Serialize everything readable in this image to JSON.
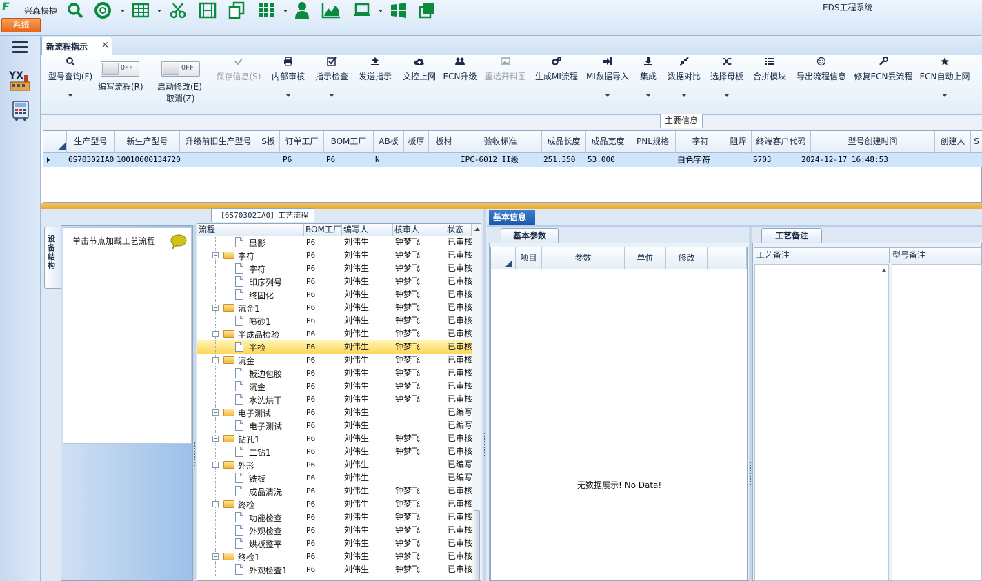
{
  "app": {
    "name": "兴森快捷",
    "system_tab": "系统",
    "title": "EDS工程系统"
  },
  "doc_tab": {
    "label": "新流程指示",
    "close": "×"
  },
  "toolbar": {
    "items": [
      {
        "label": "型号查询(F)",
        "icon": "search-icon"
      },
      {
        "label": "保存信息(S)",
        "icon": "check-icon",
        "disabled": true
      },
      {
        "label": "内部审核",
        "icon": "printer-icon"
      },
      {
        "label": "指示检查",
        "icon": "checkbox-icon"
      },
      {
        "label": "发送指示",
        "icon": "upload-icon"
      },
      {
        "label": "文控上网",
        "icon": "cloud-upload-icon"
      },
      {
        "label": "ECN升级",
        "icon": "people-icon"
      },
      {
        "label": "重选开料图",
        "icon": "picture-icon",
        "disabled": true
      },
      {
        "label": "生成MI流程",
        "icon": "gears-icon"
      },
      {
        "label": "MI数据导入",
        "icon": "sign-in-icon"
      },
      {
        "label": "集成",
        "icon": "download-icon"
      },
      {
        "label": "数据对比",
        "icon": "compress-icon"
      },
      {
        "label": "选择母板",
        "icon": "shuffle-icon"
      },
      {
        "label": "合拼模块",
        "icon": "list-icon"
      },
      {
        "label": "导出流程信息",
        "icon": "smile-icon"
      },
      {
        "label": "修复ECN丢流程",
        "icon": "wrench-icon"
      },
      {
        "label": "ECN自动上网",
        "icon": "star-icon"
      }
    ],
    "toggle1": {
      "label": "编写流程(R)",
      "state": "OFF"
    },
    "toggle2": {
      "label1": "启动修改(E)",
      "label2": "取消(Z)",
      "state": "OFF"
    }
  },
  "main_info": {
    "title": "主要信息",
    "headers": [
      "生产型号",
      "新生产型号",
      "升级前旧生产型号",
      "S板",
      "订单工厂",
      "BOM工厂",
      "AB板",
      "板厚",
      "板材",
      "验收标准",
      "成品长度",
      "成品宽度",
      "PNL规格",
      "字符",
      "阻焊",
      "终端客户代码",
      "型号创建时间",
      "创建人",
      "S"
    ],
    "row": [
      "6S70302IA0",
      "10010600134720",
      "",
      "",
      "P6",
      "P6",
      "N",
      "",
      "",
      "IPC-6012 II级",
      "251.350",
      "53.000",
      "",
      "白色字符",
      "",
      "S703",
      "2024-12-17 16:48:53",
      "",
      ""
    ]
  },
  "left_panel": {
    "vtab": "设备结构",
    "hint": "单击节点加载工艺流程"
  },
  "tree": {
    "title": "【6S70302IA0】工艺流程",
    "headers": [
      "流程",
      "BOM工厂",
      "编写人",
      "核审人",
      "状态"
    ],
    "rows": [
      {
        "level": 1,
        "name": "显影",
        "bom": "P6",
        "writer": "刘伟生",
        "reviewer": "钟梦飞",
        "status": "已审核"
      },
      {
        "level": 0,
        "name": "字符",
        "bom": "P6",
        "writer": "刘伟生",
        "reviewer": "钟梦飞",
        "status": "已审核"
      },
      {
        "level": 1,
        "name": "字符",
        "bom": "P6",
        "writer": "刘伟生",
        "reviewer": "钟梦飞",
        "status": "已审核"
      },
      {
        "level": 1,
        "name": "印序列号",
        "bom": "P6",
        "writer": "刘伟生",
        "reviewer": "钟梦飞",
        "status": "已审核"
      },
      {
        "level": 1,
        "name": "终固化",
        "bom": "P6",
        "writer": "刘伟生",
        "reviewer": "钟梦飞",
        "status": "已审核"
      },
      {
        "level": 0,
        "name": "沉金1",
        "bom": "P6",
        "writer": "刘伟生",
        "reviewer": "钟梦飞",
        "status": "已审核"
      },
      {
        "level": 1,
        "name": "喷砂1",
        "bom": "P6",
        "writer": "刘伟生",
        "reviewer": "钟梦飞",
        "status": "已审核"
      },
      {
        "level": 0,
        "name": "半成品检验",
        "bom": "P6",
        "writer": "刘伟生",
        "reviewer": "钟梦飞",
        "status": "已审核"
      },
      {
        "level": 1,
        "name": "半检",
        "bom": "P6",
        "writer": "刘伟生",
        "reviewer": "钟梦飞",
        "status": "已审核",
        "selected": true
      },
      {
        "level": 0,
        "name": "沉金",
        "bom": "P6",
        "writer": "刘伟生",
        "reviewer": "钟梦飞",
        "status": "已审核"
      },
      {
        "level": 1,
        "name": "板边包胶",
        "bom": "P6",
        "writer": "刘伟生",
        "reviewer": "钟梦飞",
        "status": "已审核"
      },
      {
        "level": 1,
        "name": "沉金",
        "bom": "P6",
        "writer": "刘伟生",
        "reviewer": "钟梦飞",
        "status": "已审核"
      },
      {
        "level": 1,
        "name": "水洗烘干",
        "bom": "P6",
        "writer": "刘伟生",
        "reviewer": "钟梦飞",
        "status": "已审核"
      },
      {
        "level": 0,
        "name": "电子测试",
        "bom": "P6",
        "writer": "刘伟生",
        "reviewer": "",
        "status": "已编写"
      },
      {
        "level": 1,
        "name": "电子测试",
        "bom": "P6",
        "writer": "刘伟生",
        "reviewer": "",
        "status": "已编写"
      },
      {
        "level": 0,
        "name": "钻孔1",
        "bom": "P6",
        "writer": "刘伟生",
        "reviewer": "钟梦飞",
        "status": "已审核"
      },
      {
        "level": 1,
        "name": "二钻1",
        "bom": "P6",
        "writer": "刘伟生",
        "reviewer": "钟梦飞",
        "status": "已审核"
      },
      {
        "level": 0,
        "name": "外形",
        "bom": "P6",
        "writer": "刘伟生",
        "reviewer": "",
        "status": "已编写"
      },
      {
        "level": 1,
        "name": "铣板",
        "bom": "P6",
        "writer": "刘伟生",
        "reviewer": "",
        "status": "已编写"
      },
      {
        "level": 1,
        "name": "成品清洗",
        "bom": "P6",
        "writer": "刘伟生",
        "reviewer": "钟梦飞",
        "status": "已审核"
      },
      {
        "level": 0,
        "name": "终检",
        "bom": "P6",
        "writer": "刘伟生",
        "reviewer": "钟梦飞",
        "status": "已审核"
      },
      {
        "level": 1,
        "name": "功能检查",
        "bom": "P6",
        "writer": "刘伟生",
        "reviewer": "钟梦飞",
        "status": "已审核"
      },
      {
        "level": 1,
        "name": "外观检查",
        "bom": "P6",
        "writer": "刘伟生",
        "reviewer": "钟梦飞",
        "status": "已审核"
      },
      {
        "level": 1,
        "name": "烘板整平",
        "bom": "P6",
        "writer": "刘伟生",
        "reviewer": "钟梦飞",
        "status": "已审核"
      },
      {
        "level": 0,
        "name": "终检1",
        "bom": "P6",
        "writer": "刘伟生",
        "reviewer": "钟梦飞",
        "status": "已审核"
      },
      {
        "level": 1,
        "name": "外观检查1",
        "bom": "P6",
        "writer": "刘伟生",
        "reviewer": "钟梦飞",
        "status": "已审核"
      }
    ]
  },
  "info": {
    "tab": "基本信息",
    "param_tab": "基本参数",
    "param_headers": [
      "项目",
      "参数",
      "单位",
      "修改"
    ],
    "no_data": "无数据展示! No Data!",
    "remark_tab": "工艺备注",
    "remark_headers": [
      "工艺备注",
      "型号备注"
    ]
  }
}
